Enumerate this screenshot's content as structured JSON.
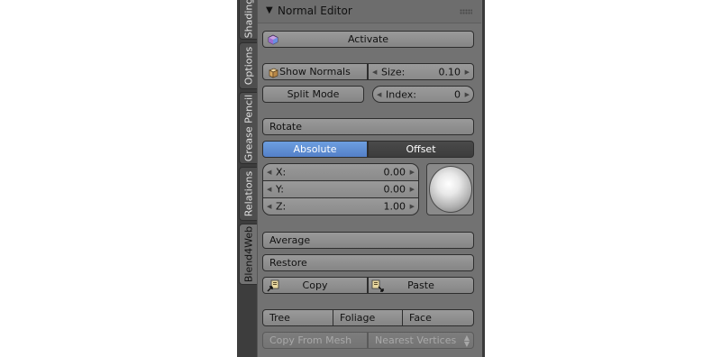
{
  "tabs": [
    {
      "label": "Shading",
      "active": false
    },
    {
      "label": "Options",
      "active": false
    },
    {
      "label": "Grease Pencil",
      "active": false
    },
    {
      "label": "Relations",
      "active": false
    },
    {
      "label": "Blend4Web",
      "active": true
    }
  ],
  "panel": {
    "title": "Normal Editor",
    "activate_label": "Activate",
    "show_normals_label": "Show Normals",
    "size": {
      "label": "Size:",
      "value": "0.10"
    },
    "split_mode_label": "Split Mode",
    "index": {
      "label": "Index:",
      "value": "0"
    },
    "rotate_label": "Rotate",
    "mode": {
      "absolute_label": "Absolute",
      "offset_label": "Offset",
      "selected": "Absolute"
    },
    "x": {
      "label": "X:",
      "value": "0.00"
    },
    "y": {
      "label": "Y:",
      "value": "0.00"
    },
    "z": {
      "label": "Z:",
      "value": "1.00"
    },
    "average_label": "Average",
    "restore_label": "Restore",
    "copy_label": "Copy",
    "paste_label": "Paste",
    "tree_label": "Tree",
    "foliage_label": "Foliage",
    "face_label": "Face",
    "copy_from_mesh_label": "Copy From Mesh",
    "nearest_vertices_label": "Nearest Vertices"
  },
  "colors": {
    "accent": "#5680c9",
    "panel_bg": "#727272"
  }
}
